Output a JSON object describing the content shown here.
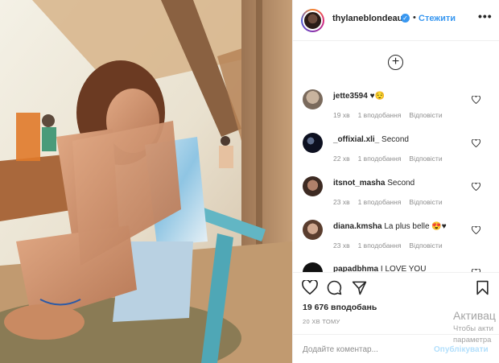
{
  "header": {
    "username": "thylaneblondeau",
    "follow_label": "Стежити",
    "more_label": "•••"
  },
  "comments": [
    {
      "username": "jette3594",
      "text": "♥😌",
      "age": "19 хв",
      "likes": "1 вподобання",
      "reply": "Відповісти"
    },
    {
      "username": "_offixial.xli_",
      "text": "Second",
      "age": "22 хв",
      "likes": "1 вподобання",
      "reply": "Відповісти"
    },
    {
      "username": "itsnot_masha",
      "text": "Second",
      "age": "23 хв",
      "likes": "1 вподобання",
      "reply": "Відповісти"
    },
    {
      "username": "diana.kmsha",
      "text": "La plus belle 😍♥",
      "age": "23 хв",
      "likes": "1 вподобання",
      "reply": "Відповісти"
    },
    {
      "username": "papadbhma",
      "text": "I LOVE YOU",
      "age": "",
      "likes": "",
      "reply": ""
    }
  ],
  "post": {
    "likes_count": "19 676 вподобань",
    "time_ago": "20 ХВ ТОМУ"
  },
  "comment_box": {
    "placeholder": "Додайте коментар...",
    "post_label": "Опублікувати"
  },
  "watermark": {
    "line1": "Активац",
    "line2": "Чтобы акти",
    "line3": "параметра"
  },
  "colors": {
    "link_blue": "#3897f0",
    "post_disabled": "#b2dffc",
    "meta_gray": "#8e8e8e"
  }
}
